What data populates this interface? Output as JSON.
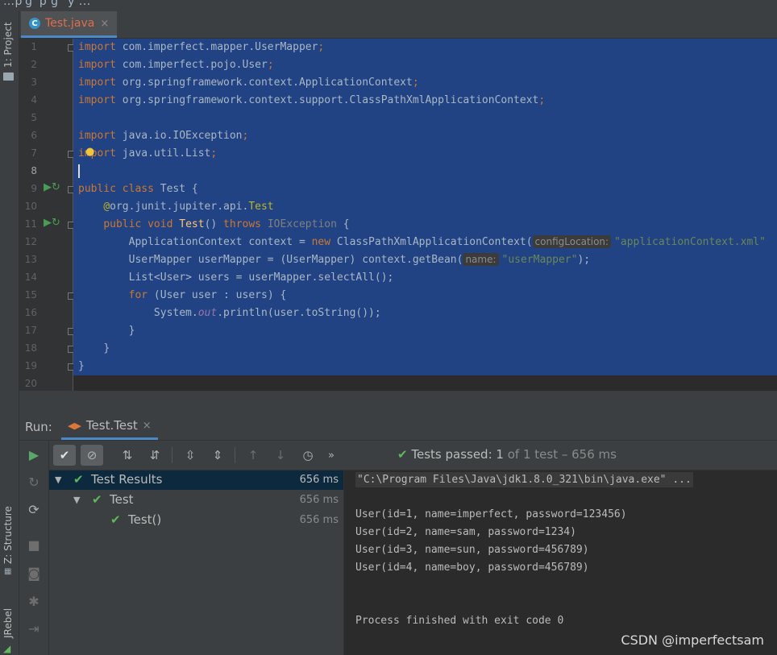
{
  "top_breadcrumb": "…p g   p  g   y  ...",
  "left_strip": {
    "project_label": "1: Project",
    "structure_label": "Z: Structure",
    "jrebel_label": "JRebel"
  },
  "editor": {
    "tab_label": "Test.java",
    "tab_close": "×",
    "line_numbers": [
      "1",
      "2",
      "3",
      "4",
      "5",
      "6",
      "7",
      "8",
      "9",
      "10",
      "11",
      "12",
      "13",
      "14",
      "15",
      "16",
      "17",
      "18",
      "19",
      "20"
    ],
    "code": {
      "l1_kw": "import",
      "l1_rest": " com.imperfect.mapper.UserMapper",
      "l1_semi": ";",
      "l2_kw": "import",
      "l2_rest": " com.imperfect.pojo.User",
      "l2_semi": ";",
      "l3_kw": "import",
      "l3_rest": " org.springframework.context.ApplicationContext",
      "l3_semi": ";",
      "l4_kw": "import",
      "l4_rest": " org.springframework.context.support.ClassPathXmlApplicationContext",
      "l4_semi": ";",
      "l6_kw": "import",
      "l6_rest": " java.io.IOException",
      "l6_semi": ";",
      "l7_kw": "import",
      "l7_rest": " java.util.List",
      "l7_semi": ";",
      "l9_kw1": "public",
      "l9_kw2": "class",
      "l9_rest": " Test {",
      "l10_at": "@",
      "l10_pkg": "org.junit.jupiter.api.",
      "l10_ann": "Test",
      "l11_kw1": "public",
      "l11_kw2": "void",
      "l11_fn": "Test",
      "l11_paren": "() ",
      "l11_kw3": "throws",
      "l11_exc": "IOException",
      "l11_brace": " {",
      "l12_a": "ApplicationContext context = ",
      "l12_kw": "new",
      "l12_b": " ClassPathXmlApplicationContext(",
      "l12_hint": "configLocation:",
      "l12_str": "\"applicationContext.xml\"",
      "l13_a": "UserMapper userMapper = (UserMapper) context.getBean(",
      "l13_hint": "name:",
      "l13_str": "\"userMapper\"",
      "l13_b": ");",
      "l14": "List<User> users = userMapper.selectAll();",
      "l15_kw": "for",
      "l15_rest": " (User user : users) {",
      "l16_a": "System.",
      "l16_out": "out",
      "l16_b": ".println(user.toString());",
      "l17": "}",
      "l18": "}",
      "l19": "}"
    }
  },
  "run": {
    "label": "Run:",
    "tab_label": "Test.Test",
    "tab_close": "×",
    "status_prefix": "Tests passed:",
    "status_count": "1",
    "status_suffix": "of 1 test – 656 ms",
    "tree": [
      {
        "label": "Test Results",
        "duration": "656 ms"
      },
      {
        "label": "Test",
        "duration": "656 ms"
      },
      {
        "label": "Test()",
        "duration": "656 ms"
      }
    ],
    "console": {
      "command": "\"C:\\Program Files\\Java\\jdk1.8.0_321\\bin\\java.exe\" ...",
      "lines": [
        "User(id=1, name=imperfect, password=123456)",
        "User(id=2, name=sam, password=1234)",
        "User(id=3, name=sun, password=456789)",
        "User(id=4, name=boy, password=456789)"
      ],
      "exit": "Process finished with exit code 0"
    }
  },
  "watermark": "CSDN @imperfectsam",
  "colors": {
    "selection": "#214283",
    "keyword": "#cc7832",
    "string": "#6a8759",
    "annotation": "#bbb529",
    "pass_green": "#5fb85d",
    "tab_accent": "#4a88c7"
  }
}
